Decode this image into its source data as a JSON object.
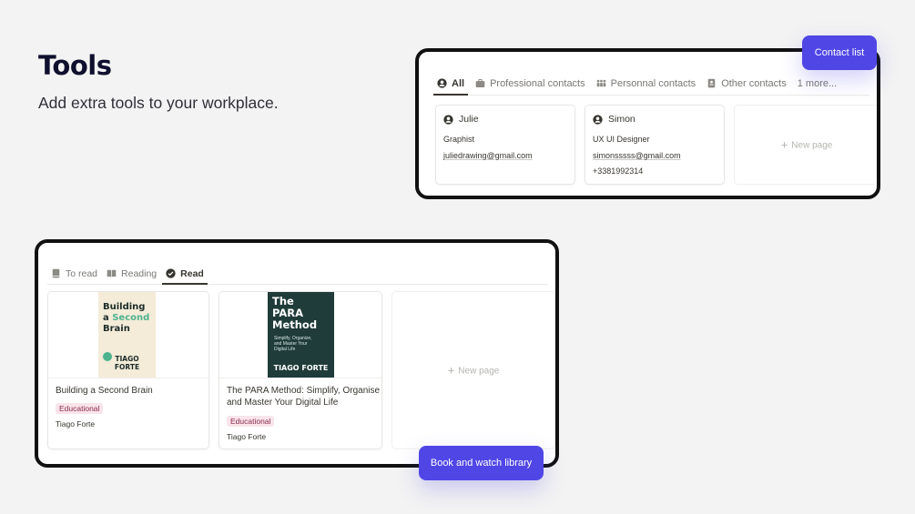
{
  "hero": {
    "title": "Tools",
    "subtitle": "Add extra tools to your workplace."
  },
  "contacts": {
    "tabs": [
      {
        "label": "All",
        "icon": "user-circle-icon",
        "active": true
      },
      {
        "label": "Professional contacts",
        "icon": "briefcase-icon",
        "active": false
      },
      {
        "label": "Personnal contacts",
        "icon": "group-icon",
        "active": false
      },
      {
        "label": "Other contacts",
        "icon": "contact-book-icon",
        "active": false
      }
    ],
    "more_label": "1 more...",
    "cards": [
      {
        "name": "Julie",
        "role": "Graphist",
        "email": "juliedrawing@gmail.com",
        "phone": ""
      },
      {
        "name": "Simon",
        "role": "UX UI Designer",
        "email": "simonsssss@gmail.com",
        "phone": "+3381992314"
      }
    ],
    "new_page_label": "New page",
    "badge_label": "Contact list"
  },
  "books": {
    "tabs": [
      {
        "label": "To read",
        "icon": "book-icon",
        "active": false
      },
      {
        "label": "Reading",
        "icon": "open-book-icon",
        "active": false
      },
      {
        "label": "Read",
        "icon": "check-circle-icon",
        "active": true
      }
    ],
    "cards": [
      {
        "title": "Building a Second Brain",
        "tag": "Educational",
        "author": "Tiago Forte",
        "cover": {
          "line1": "Building",
          "line2a": "a",
          "line2b": "Second",
          "line3": "Brain",
          "author": "TIAGO\nFORTE",
          "author1": "TIAGO",
          "author2": "FORTE"
        }
      },
      {
        "title_line1": "The PARA Method: Simplify, Organise",
        "title_line2": "and Master Your Digital Life",
        "tag": "Educational",
        "author": "Tiago Forte",
        "cover": {
          "line1": "The",
          "line2": "PARA",
          "line3": "Method",
          "sub1": "Simplify, Organize,",
          "sub2": "and Master Your",
          "sub3": "Digital Life",
          "author": "TIAGO FORTE"
        }
      }
    ],
    "new_page_label": "New page",
    "badge_label": "Book and watch library"
  },
  "colors": {
    "accent": "#5046e5",
    "tag_bg": "#f9e4ea",
    "tag_text": "#8b2c4e",
    "para_cover": "#1f3b3a",
    "bsb_cover": "#f4ecd8"
  }
}
